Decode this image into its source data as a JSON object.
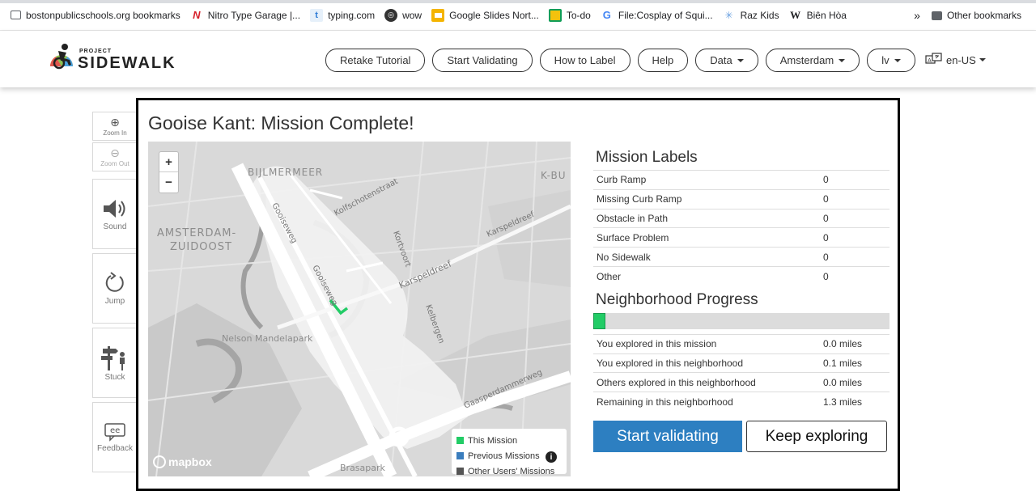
{
  "bookmarks": {
    "items": [
      {
        "label": "bostonpublicschools.org bookmarks",
        "icon": "folder-icon"
      },
      {
        "label": "Nitro Type Garage |...",
        "icon": "nitro-type-icon"
      },
      {
        "label": "typing.com",
        "icon": "typing-icon"
      },
      {
        "label": "wow",
        "icon": "globe-icon"
      },
      {
        "label": "Google Slides Nort...",
        "icon": "google-slides-icon"
      },
      {
        "label": "To-do",
        "icon": "classroom-icon"
      },
      {
        "label": "File:Cosplay of Squi...",
        "icon": "google-icon"
      },
      {
        "label": "Raz Kids",
        "icon": "raz-kids-icon"
      },
      {
        "label": "Biên Hòa",
        "icon": "wikipedia-icon"
      }
    ],
    "overflow": "»",
    "other": "Other bookmarks"
  },
  "header": {
    "logo_small": "PROJECT",
    "logo_big": "SIDEWALK",
    "nav": [
      {
        "label": "Retake Tutorial",
        "dropdown": false
      },
      {
        "label": "Start Validating",
        "dropdown": false
      },
      {
        "label": "How to Label",
        "dropdown": false
      },
      {
        "label": "Help",
        "dropdown": false
      },
      {
        "label": "Data",
        "dropdown": true
      },
      {
        "label": "Amsterdam",
        "dropdown": true
      },
      {
        "label": "lv",
        "dropdown": true
      }
    ],
    "language": "en-US"
  },
  "toolbar": {
    "zoom_in": "Zoom In",
    "zoom_out": "Zoom Out",
    "sound": "Sound",
    "jump": "Jump",
    "stuck": "Stuck",
    "feedback": "Feedback"
  },
  "modal": {
    "title": "Gooise Kant: Mission Complete!",
    "map": {
      "zoom_in": "+",
      "zoom_out": "−",
      "labels": {
        "bijlmermeer": "BIJLMERMEER",
        "kbu": "K-BU",
        "amsterdam": "AMSTERDAM-",
        "zuidoost": "ZUIDOOST",
        "gooiseweg1": "Gooiseweg",
        "gooiseweg2": "Gooiseweg",
        "kolfschotenstraat": "Kolfschotenstraat",
        "karspeldreef1": "Karspeldreef",
        "karspeldreef2": "Karspeldreef",
        "kortvoort": "Kortvoort",
        "kelbergen": "Kelbergen",
        "nelson": "Nelson Mandelapark",
        "gaasperdammerweg": "Gaasperdammerweg",
        "brasapark": "Brasapark"
      },
      "legend": [
        {
          "label": "This Mission",
          "color": "#22cc66"
        },
        {
          "label": "Previous Missions",
          "color": "#3a7dbd"
        },
        {
          "label": "Other Users' Missions",
          "color": "#555555"
        }
      ],
      "attribution": "mapbox"
    },
    "mission_labels": {
      "title": "Mission Labels",
      "rows": [
        {
          "label": "Curb Ramp",
          "value": "0"
        },
        {
          "label": "Missing Curb Ramp",
          "value": "0"
        },
        {
          "label": "Obstacle in Path",
          "value": "0"
        },
        {
          "label": "Surface Problem",
          "value": "0"
        },
        {
          "label": "No Sidewalk",
          "value": "0"
        },
        {
          "label": "Other",
          "value": "0"
        }
      ]
    },
    "neighborhood": {
      "title": "Neighborhood Progress",
      "progress_fraction": 0.04,
      "rows": [
        {
          "label": "You explored in this mission",
          "value": "0.0 miles"
        },
        {
          "label": "You explored in this neighborhood",
          "value": "0.1 miles"
        },
        {
          "label": "Others explored in this neighborhood",
          "value": "0.0 miles"
        },
        {
          "label": "Remaining in this neighborhood",
          "value": "1.3 miles"
        }
      ]
    },
    "buttons": {
      "primary": "Start validating",
      "secondary": "Keep exploring"
    }
  }
}
